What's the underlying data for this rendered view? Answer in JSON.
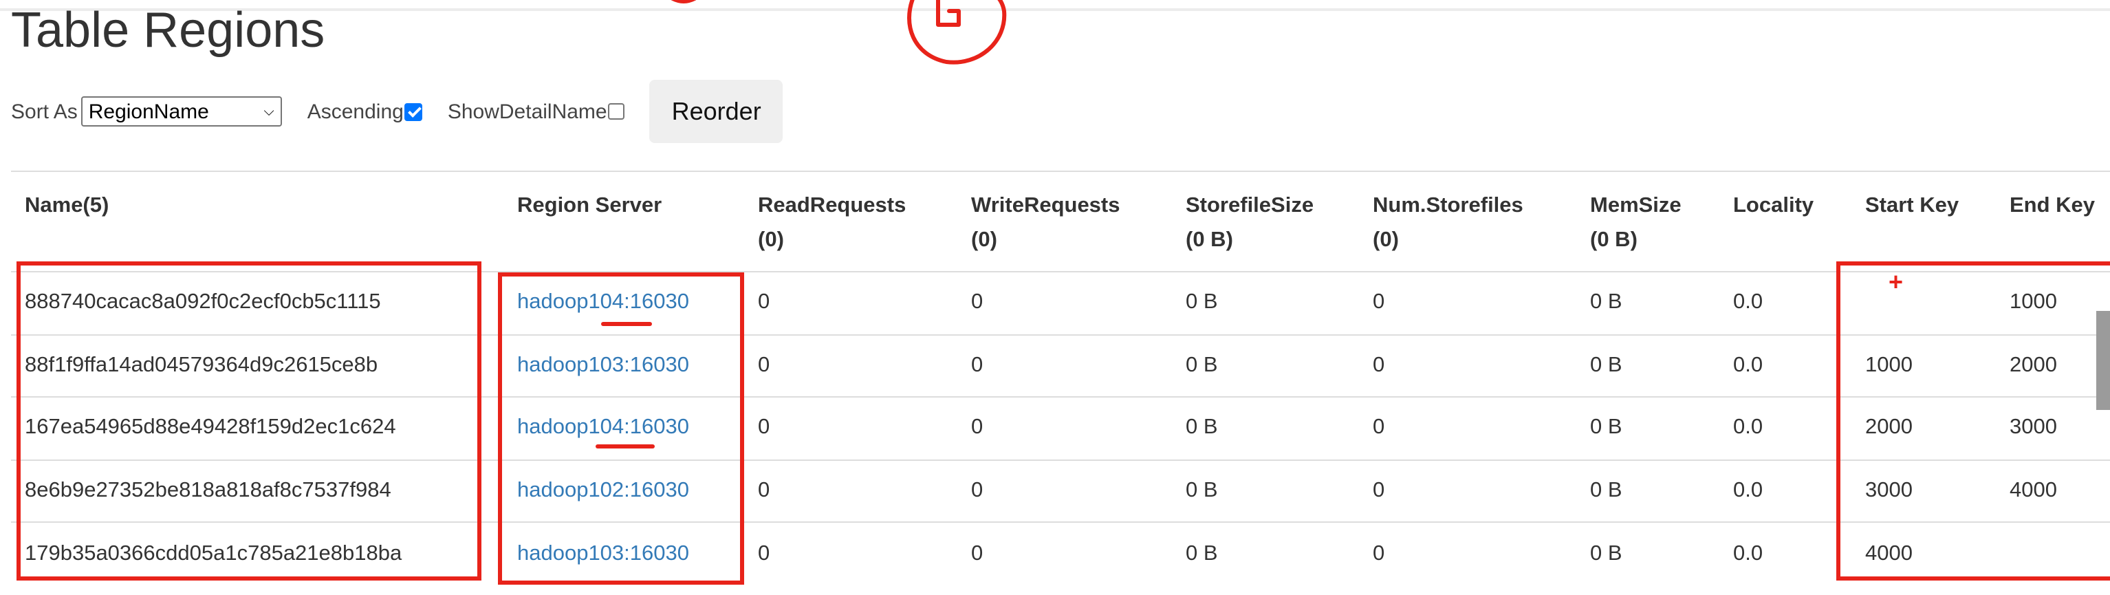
{
  "page_title": "Table Regions",
  "controls": {
    "sort_label": "Sort As",
    "sort_selected": "RegionName",
    "ascending_label": "Ascending",
    "ascending_checked": true,
    "show_detail_label": "ShowDetailName",
    "show_detail_checked": false,
    "reorder_label": "Reorder"
  },
  "table": {
    "headers": [
      {
        "line1": "Name(5)",
        "line2": ""
      },
      {
        "line1": "Region Server",
        "line2": ""
      },
      {
        "line1": "ReadRequests",
        "line2": "(0)"
      },
      {
        "line1": "WriteRequests",
        "line2": "(0)"
      },
      {
        "line1": "StorefileSize",
        "line2": "(0 B)"
      },
      {
        "line1": "Num.Storefiles",
        "line2": "(0)"
      },
      {
        "line1": "MemSize",
        "line2": "(0 B)"
      },
      {
        "line1": "Locality",
        "line2": ""
      },
      {
        "line1": "Start Key",
        "line2": ""
      },
      {
        "line1": "End Key",
        "line2": ""
      }
    ],
    "rows": [
      {
        "name": "888740cacac8a092f0c2ecf0cb5c1115",
        "server": "hadoop104:16030",
        "read": "0",
        "write": "0",
        "storefile_size": "0 B",
        "num_storefiles": "0",
        "memsize": "0 B",
        "locality": "0.0",
        "start_key": "",
        "end_key": "1000"
      },
      {
        "name": "88f1f9ffa14ad04579364d9c2615ce8b",
        "server": "hadoop103:16030",
        "read": "0",
        "write": "0",
        "storefile_size": "0 B",
        "num_storefiles": "0",
        "memsize": "0 B",
        "locality": "0.0",
        "start_key": "1000",
        "end_key": "2000"
      },
      {
        "name": "167ea54965d88e49428f159d2ec1c624",
        "server": "hadoop104:16030",
        "read": "0",
        "write": "0",
        "storefile_size": "0 B",
        "num_storefiles": "0",
        "memsize": "0 B",
        "locality": "0.0",
        "start_key": "2000",
        "end_key": "3000"
      },
      {
        "name": "8e6b9e27352be818a818af8c7537f984",
        "server": "hadoop102:16030",
        "read": "0",
        "write": "0",
        "storefile_size": "0 B",
        "num_storefiles": "0",
        "memsize": "0 B",
        "locality": "0.0",
        "start_key": "3000",
        "end_key": "4000"
      },
      {
        "name": "179b35a0366cdd05a1c785a21e8b18ba",
        "server": "hadoop103:16030",
        "read": "0",
        "write": "0",
        "storefile_size": "0 B",
        "num_storefiles": "0",
        "memsize": "0 B",
        "locality": "0.0",
        "start_key": "4000",
        "end_key": ""
      }
    ]
  },
  "annotations": {
    "color": "#e8231a",
    "start_key_mark": "+"
  },
  "icons": {
    "next": "chevron-right-icon"
  },
  "colors": {
    "link": "#337ab7",
    "checkbox_checked": "#0075ff"
  }
}
